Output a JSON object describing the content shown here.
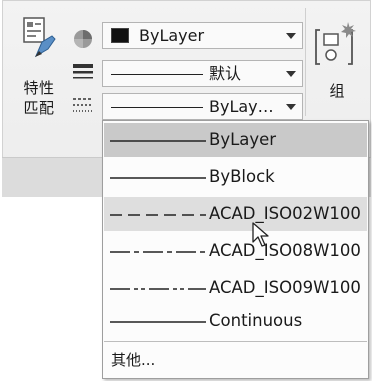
{
  "panel": {
    "match_properties": {
      "label_line1": "特性",
      "label_line2": "匹配",
      "icon": "match-properties-icon"
    },
    "color_combo": {
      "value": "ByLayer",
      "swatch_color": "#111111"
    },
    "lineweight_combo": {
      "value": "默认"
    },
    "linetype_combo": {
      "value": "ByLay…"
    },
    "group": {
      "label": "组",
      "icon": "group-icon"
    }
  },
  "linetype_dropdown": {
    "items": [
      {
        "label": "ByLayer",
        "pattern": "solid",
        "selected": true
      },
      {
        "label": "ByBlock",
        "pattern": "solid"
      },
      {
        "label": "ACAD_ISO02W100",
        "pattern": "dashed",
        "hover": true
      },
      {
        "label": "ACAD_ISO08W100",
        "pattern": "long-dash-short-dash"
      },
      {
        "label": "ACAD_ISO09W100",
        "pattern": "long-dash-double-short-dash"
      },
      {
        "label": "Continuous",
        "pattern": "solid"
      }
    ],
    "other_label": "其他..."
  }
}
